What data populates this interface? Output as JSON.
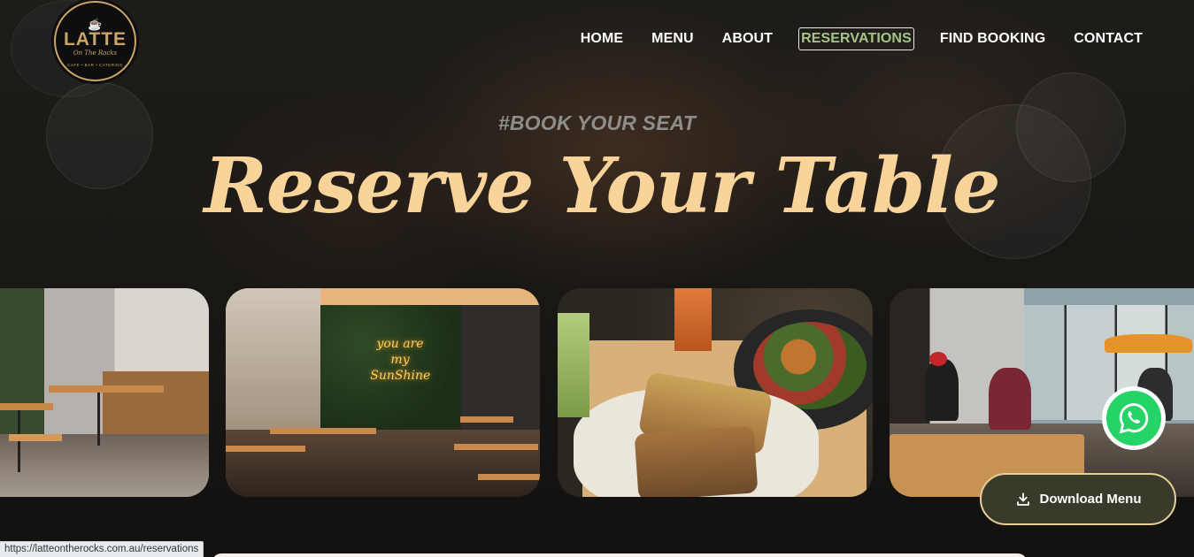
{
  "brand": {
    "logo_main": "LATTE",
    "logo_script": "On The Rocks",
    "logo_tagline": "CAFE • BAR • CATERING"
  },
  "nav": {
    "items": [
      {
        "label": "HOME"
      },
      {
        "label": "MENU"
      },
      {
        "label": "ABOUT"
      },
      {
        "label": "RESERVATIONS",
        "active": true
      },
      {
        "label": "FIND BOOKING"
      },
      {
        "label": "CONTACT"
      }
    ]
  },
  "hero": {
    "eyebrow": "#BOOK YOUR SEAT",
    "headline": "Reserve Your Table"
  },
  "gallery": {
    "neon_sign": "you are my SunShine"
  },
  "floating": {
    "download_label": "Download Menu",
    "whatsapp_icon": "whatsapp-icon"
  },
  "status_bar": {
    "url": "https://latteontherocks.com.au/reservations"
  },
  "colors": {
    "headline": "#f8d49a",
    "active_nav": "#a6c48a",
    "download_border": "#e6cf98",
    "whatsapp": "#25d366"
  }
}
